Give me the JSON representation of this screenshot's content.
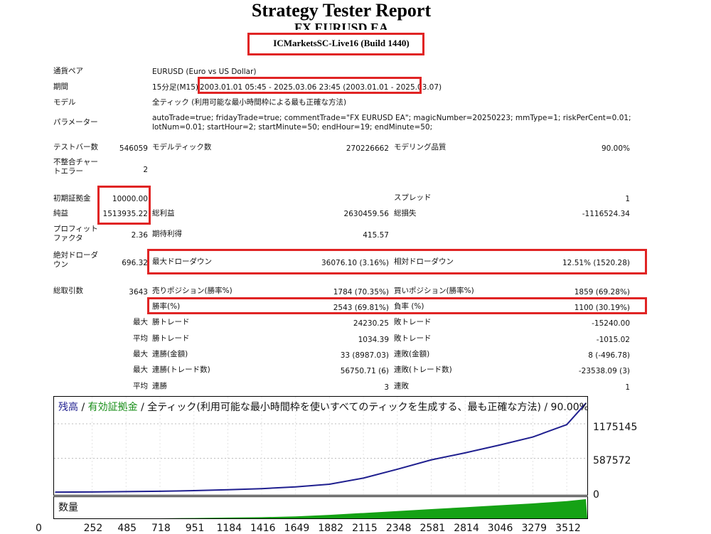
{
  "header": {
    "title": "Strategy Tester Report",
    "ea_name": "FX EURUSD EA",
    "server": "ICMarketsSC-Live16 (Build 1440)"
  },
  "info": {
    "pair_label": "通貨ペア",
    "pair_value": "EURUSD (Euro vs US Dollar)",
    "period_label": "期間",
    "period_timeframe": "15分足(M15)",
    "period_range": "2003.01.01 05:45 - 2025.03.06 23:45 (2003.01.01 - 2025.03.07)",
    "model_label": "モデル",
    "model_value": "全ティック (利用可能な最小時間枠による最も正確な方法)",
    "params_label": "パラメーター",
    "params_line1": "autoTrade=true; fridayTrade=true; commentTrade=\"FX EURUSD EA\"; magicNumber=20250223; mmType=1; riskPerCent=0.01;",
    "params_line2": "lotNum=0.01; startHour=2; startMinute=50; endHour=19; endMinute=50;"
  },
  "stats": {
    "bars_label": "テストバー数",
    "bars_value": "546059",
    "ticks_label": "モデルティック数",
    "ticks_value": "270226662",
    "quality_label": "モデリング品質",
    "quality_value": "90.00%",
    "mismatch_label": "不整合チャートエラー",
    "mismatch_value": "2",
    "deposit_label": "初期証拠金",
    "deposit_value": "10000.00",
    "spread_label": "スプレッド",
    "spread_value": "1",
    "net_label": "純益",
    "net_value": "1513935.22",
    "gross_profit_label": "総利益",
    "gross_profit_value": "2630459.56",
    "gross_loss_label": "総損失",
    "gross_loss_value": "-1116524.34",
    "pf_label": "プロフィットファクタ",
    "pf_value": "2.36",
    "expected_label": "期待利得",
    "expected_value": "415.57",
    "abs_dd_label": "絶対ドローダウン",
    "abs_dd_value": "696.32",
    "max_dd_label": "最大ドローダウン",
    "max_dd_value": "36076.10 (3.16%)",
    "rel_dd_label": "相対ドローダウン",
    "rel_dd_value": "12.51% (1520.28)",
    "trades_label": "総取引数",
    "trades_value": "3643",
    "short_label": "売りポジション(勝率%)",
    "short_value": "1784 (70.35%)",
    "long_label": "買いポジション(勝率%)",
    "long_value": "1859 (69.28%)",
    "win_label": "勝率(%)",
    "win_value": "2543 (69.81%)",
    "loss_label": "負率 (%)",
    "loss_value": "1100 (30.19%)",
    "max_label": "最大",
    "avg_label": "平均",
    "best_win_label": "勝トレード",
    "best_win_value": "24230.25",
    "worst_loss_label": "敗トレード",
    "worst_loss_value": "-15240.00",
    "avg_win_label": "勝トレード",
    "avg_win_value": "1034.39",
    "avg_loss_label": "敗トレード",
    "avg_loss_value": "-1015.02",
    "max_consec_wins_label": "連勝(金額)",
    "max_consec_wins_value": "33 (8987.03)",
    "max_consec_losses_label": "連敗(金額)",
    "max_consec_losses_value": "8 (-496.78)",
    "max_consec_profit_label": "連勝(トレード数)",
    "max_consec_profit_value": "56750.71 (6)",
    "max_consec_loss_label": "連敗(トレード数)",
    "max_consec_loss_value": "-23538.09 (3)",
    "avg_consec_wins_label": "連勝",
    "avg_consec_wins_value": "3",
    "avg_consec_losses_label": "連敗",
    "avg_consec_losses_value": "1"
  },
  "chart_title": {
    "balance": "残高",
    "sep1": " / ",
    "equity": "有効証拠金",
    "rest": " / 全ティック(利用可能な最小時間枠を使いすべてのティックを生成する、最も正確な方法) / 90.00%"
  },
  "volume_label": "数量",
  "colors": {
    "balance": "#1f1f8f",
    "equity": "#1a8f1a",
    "volume": "#15a215",
    "highlight": "#e02424",
    "grid": "#bdbdbd"
  },
  "chart_data": {
    "type": "line",
    "x": [
      0,
      252,
      485,
      718,
      951,
      1184,
      1416,
      1649,
      1882,
      2115,
      2348,
      2581,
      2814,
      3046,
      3279,
      3512,
      3643
    ],
    "x_ticks": [
      "0",
      "252",
      "485",
      "718",
      "951",
      "1184",
      "1416",
      "1649",
      "1882",
      "2115",
      "2348",
      "2581",
      "2814",
      "3046",
      "3279",
      "3512"
    ],
    "y_ticks": [
      "1175145",
      "587572",
      "0"
    ],
    "ylim": [
      0,
      1550000
    ],
    "series": [
      {
        "name": "残高",
        "values": [
          10000,
          14000,
          19000,
          25000,
          36000,
          52000,
          70000,
          100000,
          145000,
          250000,
          400000,
          560000,
          680000,
          810000,
          950000,
          1160000,
          1523935
        ]
      }
    ],
    "volume_values": [
      0,
      0,
      0,
      0,
      0.02,
      0.04,
      0.06,
      0.1,
      0.18,
      0.28,
      0.38,
      0.48,
      0.58,
      0.68,
      0.78,
      0.9,
      1.0
    ]
  }
}
